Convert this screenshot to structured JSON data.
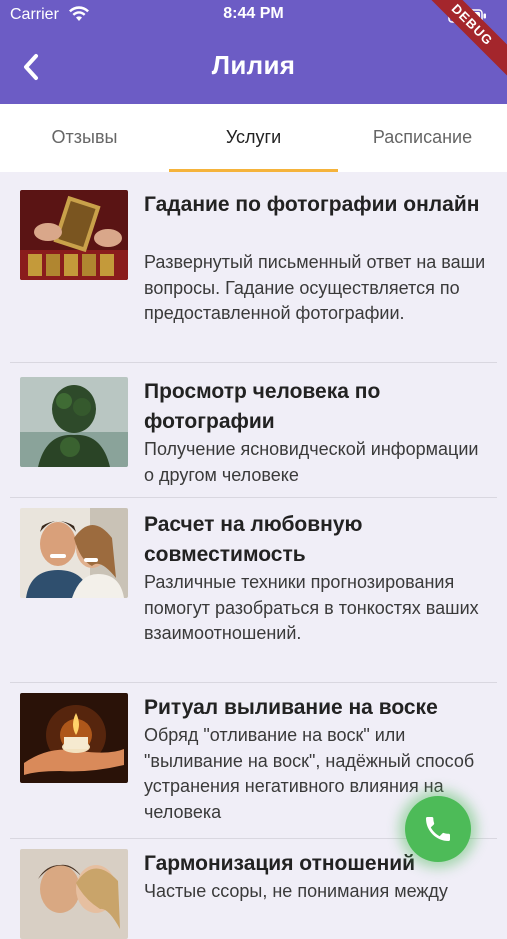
{
  "status_bar": {
    "carrier": "Carrier",
    "time": "8:44 PM"
  },
  "header": {
    "title": "Лилия",
    "debug_banner": "DEBUG"
  },
  "tabs": [
    {
      "label": "Отзывы",
      "active": false
    },
    {
      "label": "Услуги",
      "active": true
    },
    {
      "label": "Расписание",
      "active": false
    }
  ],
  "services": [
    {
      "title": "Гадание по фотографии онлайн",
      "description": "Развернутый письменный ответ на ваши вопросы. Гадание осуществляется по предоставленной фотографии."
    },
    {
      "title": "Просмотр человека по фотографии",
      "description": "Получение ясновидческой информации о другом человеке"
    },
    {
      "title": "Расчет на любовную совместимость",
      "description": "Различные техники прогнозирования помогут разобраться в тонкостях ваших взаимоотношений."
    },
    {
      "title": "Ритуал выливание на воске",
      "description": "Обряд \"отливание на воск\" или \"выливание на воск\", надёжный способ устранения негативного влияния на человека"
    },
    {
      "title": "Гармонизация отношений",
      "description": "Частые ссоры, не понимания между"
    }
  ],
  "colors": {
    "appbar": "#6c5cc5",
    "tab_indicator": "#f5b33b",
    "fab": "#4dbb58",
    "background": "#f0eef7"
  },
  "icons": {
    "back": "chevron-left-icon",
    "fab": "phone-icon"
  }
}
